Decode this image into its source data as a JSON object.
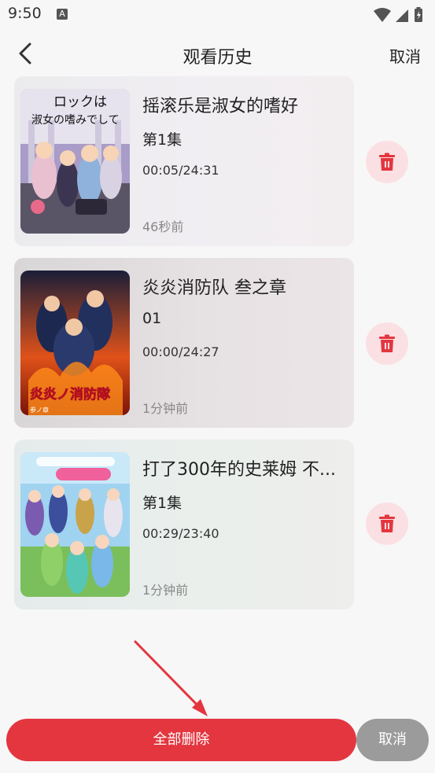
{
  "status_bar": {
    "time": "9:50",
    "a_badge": "A"
  },
  "header": {
    "title": "观看历史",
    "cancel_label": "取消",
    "back_icon": "chevron-left-icon"
  },
  "history": [
    {
      "title": "摇滚乐是淑女的嗜好",
      "episode": "第1集",
      "progress": "00:05/24:31",
      "time_ago": "46秒前"
    },
    {
      "title": "炎炎消防队 叁之章",
      "episode": "01",
      "progress": "00:00/24:27",
      "time_ago": "1分钟前"
    },
    {
      "title": "打了300年的史莱姆 不...",
      "episode": "第1集",
      "progress": "00:29/23:40",
      "time_ago": "1分钟前"
    }
  ],
  "poster_text": {
    "p1_line1": "ロックは",
    "p1_line2": "淑女の嗜みでして",
    "p2_logo": "炎炎ノ消防隊",
    "p2_sub": "参ノ章"
  },
  "footer": {
    "delete_all_label": "全部删除",
    "cancel_label": "取消"
  },
  "colors": {
    "accent": "#e3363f",
    "delete_bg": "#fbe0e3",
    "cancel_bg": "#9b9b9b"
  }
}
